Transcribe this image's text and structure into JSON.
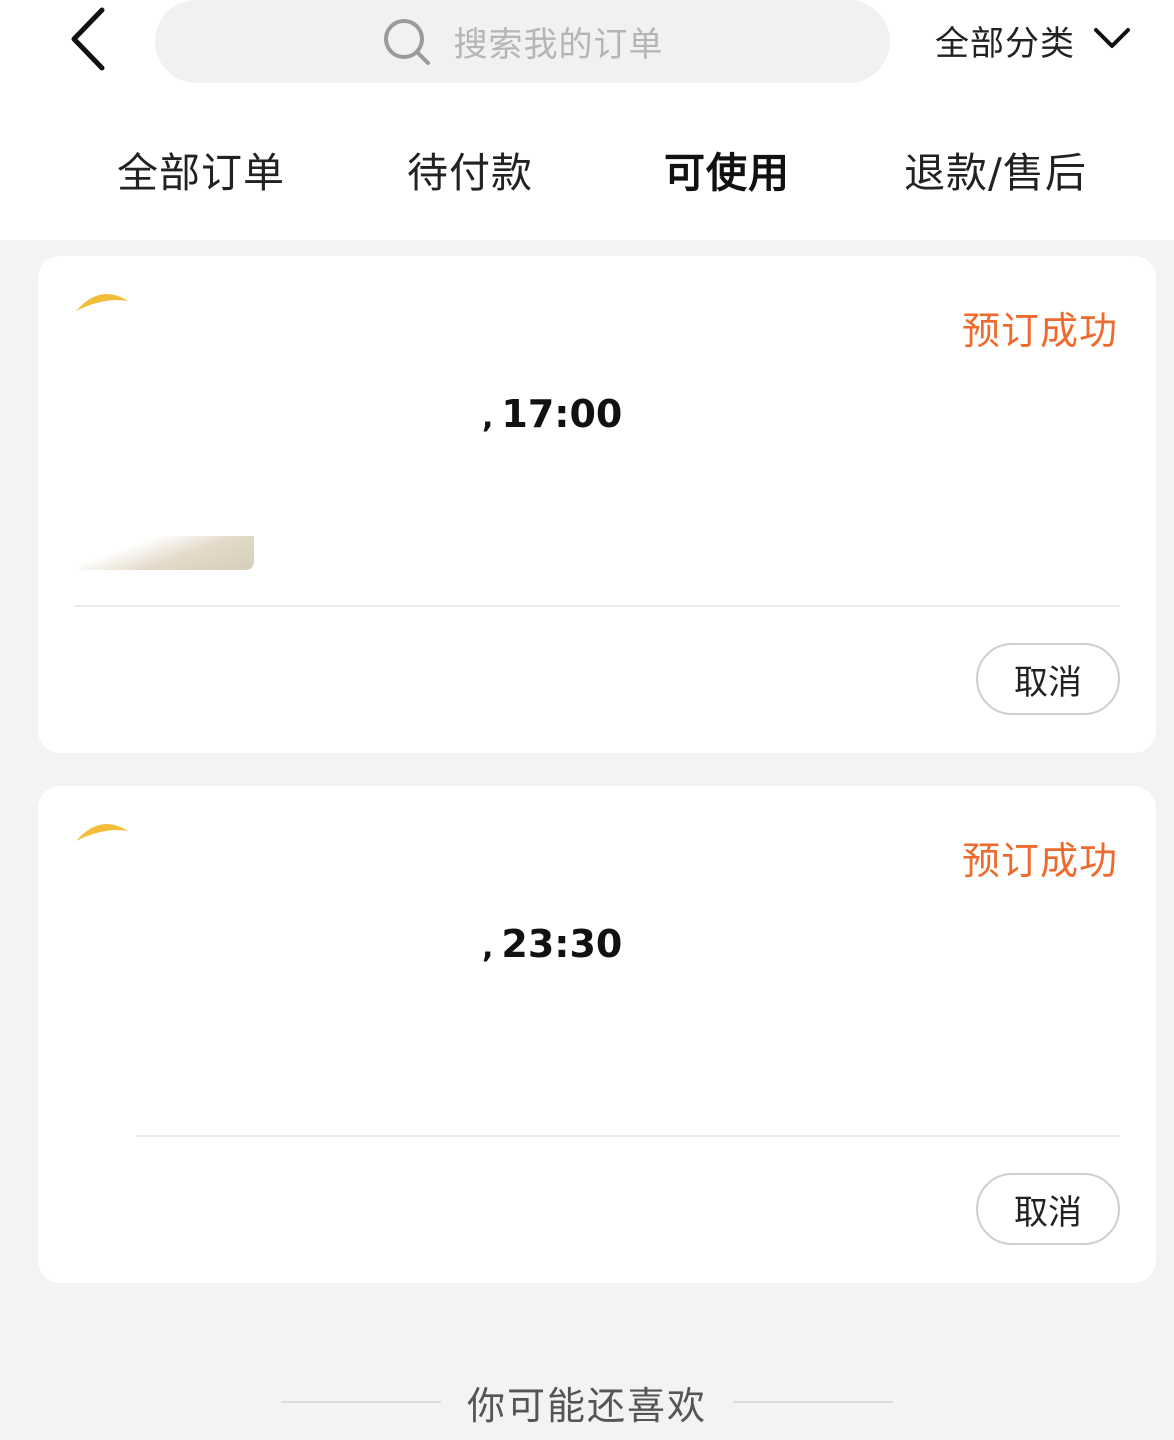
{
  "header": {
    "search_placeholder": "搜索我的订单",
    "category_label": "全部分类"
  },
  "tabs": [
    {
      "label": "全部订单",
      "active": false
    },
    {
      "label": "待付款",
      "active": false
    },
    {
      "label": "可使用",
      "active": true
    },
    {
      "label": "退款/售后",
      "active": false
    }
  ],
  "orders": [
    {
      "status": "预订成功",
      "time": "17:00",
      "cancel_label": "取消"
    },
    {
      "status": "预订成功",
      "time": "23:30",
      "cancel_label": "取消"
    }
  ],
  "recommend": {
    "title": "你可能还喜欢"
  },
  "colors": {
    "accent": "#ee6a2d",
    "tab_underline_start": "#e8432b",
    "tab_underline_end": "#f6a676",
    "logo_yellow": "#f2be3a",
    "background": "#f3f3f3"
  }
}
